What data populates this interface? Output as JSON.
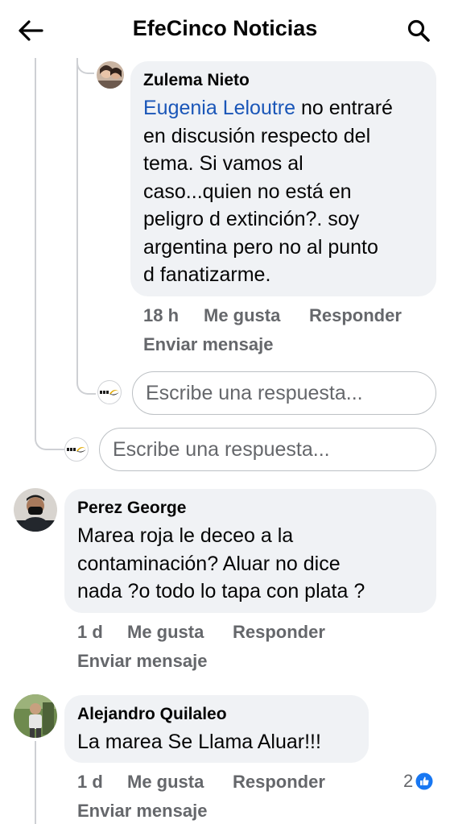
{
  "header": {
    "title": "EfeCinco Noticias",
    "back_icon": "arrow-left-icon",
    "search_icon": "search-icon"
  },
  "colors": {
    "mention": "#1a56b8",
    "bubble": "#f0f2f5",
    "meta": "#65676b",
    "like_badge": "#1877f2"
  },
  "comments": [
    {
      "author": "Zulema Nieto",
      "mention": "Eugenia Leloutre",
      "lines": [
        " no entraré",
        "en discusión respecto del",
        "tema. Si vamos al",
        "caso...quien no está en",
        "peligro d extinción?.  soy",
        "argentina pero no al punto",
        "d fanatizarme."
      ],
      "time": "18 h",
      "like": "Me gusta",
      "reply": "Responder",
      "message": "Enviar mensaje"
    },
    {
      "author": "Perez George",
      "lines": [
        "Marea roja le deceo a la",
        "contaminación? Aluar no dice",
        "nada ?o todo lo tapa con plata ?"
      ],
      "time": "1 d",
      "like": "Me gusta",
      "reply": "Responder",
      "message": "Enviar mensaje"
    },
    {
      "author": "Alejandro Quilaleo",
      "lines": [
        "La marea Se Llama Aluar!!!"
      ],
      "time": "1 d",
      "like": "Me gusta",
      "reply": "Responder",
      "message": "Enviar mensaje",
      "reaction_count": "2",
      "reaction_icon": "like-icon"
    }
  ],
  "reply_inputs": [
    {
      "placeholder": "Escribe una respuesta..."
    },
    {
      "placeholder": "Escribe una respuesta..."
    }
  ]
}
